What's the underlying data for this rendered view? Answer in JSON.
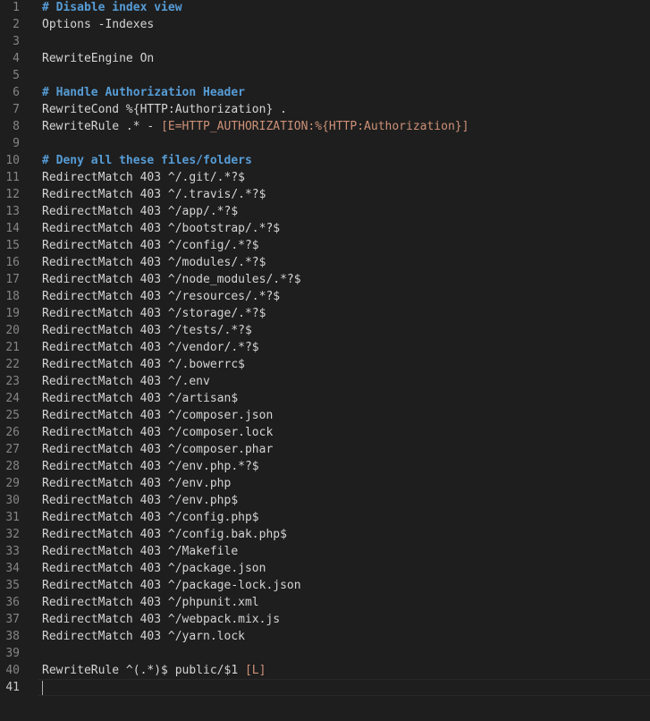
{
  "editor": {
    "lines": [
      {
        "n": "1",
        "segments": [
          {
            "t": "# Disable index view",
            "k": "comment"
          }
        ]
      },
      {
        "n": "2",
        "segments": [
          {
            "t": "Options -Indexes",
            "k": "plain"
          }
        ]
      },
      {
        "n": "3",
        "segments": []
      },
      {
        "n": "4",
        "segments": [
          {
            "t": "RewriteEngine On",
            "k": "plain"
          }
        ]
      },
      {
        "n": "5",
        "segments": []
      },
      {
        "n": "6",
        "segments": [
          {
            "t": "# Handle Authorization Header",
            "k": "comment"
          }
        ]
      },
      {
        "n": "7",
        "segments": [
          {
            "t": "RewriteCond %{HTTP:Authorization} .",
            "k": "plain"
          }
        ]
      },
      {
        "n": "8",
        "segments": [
          {
            "t": "RewriteRule .* - ",
            "k": "plain"
          },
          {
            "t": "[E=HTTP_AUTHORIZATION:%{HTTP:Authorization}]",
            "k": "bracketed"
          }
        ]
      },
      {
        "n": "9",
        "segments": []
      },
      {
        "n": "10",
        "segments": [
          {
            "t": "# Deny all these files/folders",
            "k": "comment"
          }
        ]
      },
      {
        "n": "11",
        "segments": [
          {
            "t": "RedirectMatch 403 ^/.git/.*?$",
            "k": "plain"
          }
        ]
      },
      {
        "n": "12",
        "segments": [
          {
            "t": "RedirectMatch 403 ^/.travis/.*?$",
            "k": "plain"
          }
        ]
      },
      {
        "n": "13",
        "segments": [
          {
            "t": "RedirectMatch 403 ^/app/.*?$",
            "k": "plain"
          }
        ]
      },
      {
        "n": "14",
        "segments": [
          {
            "t": "RedirectMatch 403 ^/bootstrap/.*?$",
            "k": "plain"
          }
        ]
      },
      {
        "n": "15",
        "segments": [
          {
            "t": "RedirectMatch 403 ^/config/.*?$",
            "k": "plain"
          }
        ]
      },
      {
        "n": "16",
        "segments": [
          {
            "t": "RedirectMatch 403 ^/modules/.*?$",
            "k": "plain"
          }
        ]
      },
      {
        "n": "17",
        "segments": [
          {
            "t": "RedirectMatch 403 ^/node_modules/.*?$",
            "k": "plain"
          }
        ]
      },
      {
        "n": "18",
        "segments": [
          {
            "t": "RedirectMatch 403 ^/resources/.*?$",
            "k": "plain"
          }
        ]
      },
      {
        "n": "19",
        "segments": [
          {
            "t": "RedirectMatch 403 ^/storage/.*?$",
            "k": "plain"
          }
        ]
      },
      {
        "n": "20",
        "segments": [
          {
            "t": "RedirectMatch 403 ^/tests/.*?$",
            "k": "plain"
          }
        ]
      },
      {
        "n": "21",
        "segments": [
          {
            "t": "RedirectMatch 403 ^/vendor/.*?$",
            "k": "plain"
          }
        ]
      },
      {
        "n": "22",
        "segments": [
          {
            "t": "RedirectMatch 403 ^/.bowerrc$",
            "k": "plain"
          }
        ]
      },
      {
        "n": "23",
        "segments": [
          {
            "t": "RedirectMatch 403 ^/.env",
            "k": "plain"
          }
        ]
      },
      {
        "n": "24",
        "segments": [
          {
            "t": "RedirectMatch 403 ^/artisan$",
            "k": "plain"
          }
        ]
      },
      {
        "n": "25",
        "segments": [
          {
            "t": "RedirectMatch 403 ^/composer.json",
            "k": "plain"
          }
        ]
      },
      {
        "n": "26",
        "segments": [
          {
            "t": "RedirectMatch 403 ^/composer.lock",
            "k": "plain"
          }
        ]
      },
      {
        "n": "27",
        "segments": [
          {
            "t": "RedirectMatch 403 ^/composer.phar",
            "k": "plain"
          }
        ]
      },
      {
        "n": "28",
        "segments": [
          {
            "t": "RedirectMatch 403 ^/env.php.*?$",
            "k": "plain"
          }
        ]
      },
      {
        "n": "29",
        "segments": [
          {
            "t": "RedirectMatch 403 ^/env.php",
            "k": "plain"
          }
        ]
      },
      {
        "n": "30",
        "segments": [
          {
            "t": "RedirectMatch 403 ^/env.php$",
            "k": "plain"
          }
        ]
      },
      {
        "n": "31",
        "segments": [
          {
            "t": "RedirectMatch 403 ^/config.php$",
            "k": "plain"
          }
        ]
      },
      {
        "n": "32",
        "segments": [
          {
            "t": "RedirectMatch 403 ^/config.bak.php$",
            "k": "plain"
          }
        ]
      },
      {
        "n": "33",
        "segments": [
          {
            "t": "RedirectMatch 403 ^/Makefile",
            "k": "plain"
          }
        ]
      },
      {
        "n": "34",
        "segments": [
          {
            "t": "RedirectMatch 403 ^/package.json",
            "k": "plain"
          }
        ]
      },
      {
        "n": "35",
        "segments": [
          {
            "t": "RedirectMatch 403 ^/package-lock.json",
            "k": "plain"
          }
        ]
      },
      {
        "n": "36",
        "segments": [
          {
            "t": "RedirectMatch 403 ^/phpunit.xml",
            "k": "plain"
          }
        ]
      },
      {
        "n": "37",
        "segments": [
          {
            "t": "RedirectMatch 403 ^/webpack.mix.js",
            "k": "plain"
          }
        ]
      },
      {
        "n": "38",
        "segments": [
          {
            "t": "RedirectMatch 403 ^/yarn.lock",
            "k": "plain"
          }
        ]
      },
      {
        "n": "39",
        "segments": []
      },
      {
        "n": "40",
        "segments": [
          {
            "t": "RewriteRule ^(.*)$ public/$1 ",
            "k": "plain"
          },
          {
            "t": "[L]",
            "k": "bracketed"
          }
        ]
      },
      {
        "n": "41",
        "segments": [],
        "current": true
      }
    ]
  }
}
